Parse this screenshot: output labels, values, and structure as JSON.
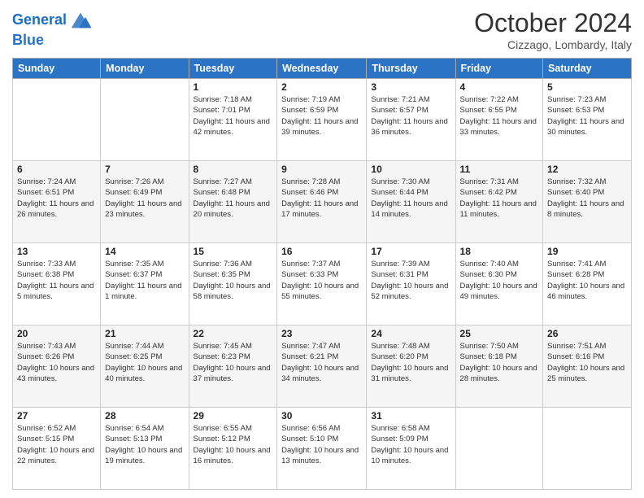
{
  "header": {
    "logo_line1": "General",
    "logo_line2": "Blue",
    "title": "October 2024",
    "subtitle": "Cizzago, Lombardy, Italy"
  },
  "days_of_week": [
    "Sunday",
    "Monday",
    "Tuesday",
    "Wednesday",
    "Thursday",
    "Friday",
    "Saturday"
  ],
  "weeks": [
    [
      {
        "day": "",
        "sunrise": "",
        "sunset": "",
        "daylight": ""
      },
      {
        "day": "",
        "sunrise": "",
        "sunset": "",
        "daylight": ""
      },
      {
        "day": "1",
        "sunrise": "Sunrise: 7:18 AM",
        "sunset": "Sunset: 7:01 PM",
        "daylight": "Daylight: 11 hours and 42 minutes."
      },
      {
        "day": "2",
        "sunrise": "Sunrise: 7:19 AM",
        "sunset": "Sunset: 6:59 PM",
        "daylight": "Daylight: 11 hours and 39 minutes."
      },
      {
        "day": "3",
        "sunrise": "Sunrise: 7:21 AM",
        "sunset": "Sunset: 6:57 PM",
        "daylight": "Daylight: 11 hours and 36 minutes."
      },
      {
        "day": "4",
        "sunrise": "Sunrise: 7:22 AM",
        "sunset": "Sunset: 6:55 PM",
        "daylight": "Daylight: 11 hours and 33 minutes."
      },
      {
        "day": "5",
        "sunrise": "Sunrise: 7:23 AM",
        "sunset": "Sunset: 6:53 PM",
        "daylight": "Daylight: 11 hours and 30 minutes."
      }
    ],
    [
      {
        "day": "6",
        "sunrise": "Sunrise: 7:24 AM",
        "sunset": "Sunset: 6:51 PM",
        "daylight": "Daylight: 11 hours and 26 minutes."
      },
      {
        "day": "7",
        "sunrise": "Sunrise: 7:26 AM",
        "sunset": "Sunset: 6:49 PM",
        "daylight": "Daylight: 11 hours and 23 minutes."
      },
      {
        "day": "8",
        "sunrise": "Sunrise: 7:27 AM",
        "sunset": "Sunset: 6:48 PM",
        "daylight": "Daylight: 11 hours and 20 minutes."
      },
      {
        "day": "9",
        "sunrise": "Sunrise: 7:28 AM",
        "sunset": "Sunset: 6:46 PM",
        "daylight": "Daylight: 11 hours and 17 minutes."
      },
      {
        "day": "10",
        "sunrise": "Sunrise: 7:30 AM",
        "sunset": "Sunset: 6:44 PM",
        "daylight": "Daylight: 11 hours and 14 minutes."
      },
      {
        "day": "11",
        "sunrise": "Sunrise: 7:31 AM",
        "sunset": "Sunset: 6:42 PM",
        "daylight": "Daylight: 11 hours and 11 minutes."
      },
      {
        "day": "12",
        "sunrise": "Sunrise: 7:32 AM",
        "sunset": "Sunset: 6:40 PM",
        "daylight": "Daylight: 11 hours and 8 minutes."
      }
    ],
    [
      {
        "day": "13",
        "sunrise": "Sunrise: 7:33 AM",
        "sunset": "Sunset: 6:38 PM",
        "daylight": "Daylight: 11 hours and 5 minutes."
      },
      {
        "day": "14",
        "sunrise": "Sunrise: 7:35 AM",
        "sunset": "Sunset: 6:37 PM",
        "daylight": "Daylight: 11 hours and 1 minute."
      },
      {
        "day": "15",
        "sunrise": "Sunrise: 7:36 AM",
        "sunset": "Sunset: 6:35 PM",
        "daylight": "Daylight: 10 hours and 58 minutes."
      },
      {
        "day": "16",
        "sunrise": "Sunrise: 7:37 AM",
        "sunset": "Sunset: 6:33 PM",
        "daylight": "Daylight: 10 hours and 55 minutes."
      },
      {
        "day": "17",
        "sunrise": "Sunrise: 7:39 AM",
        "sunset": "Sunset: 6:31 PM",
        "daylight": "Daylight: 10 hours and 52 minutes."
      },
      {
        "day": "18",
        "sunrise": "Sunrise: 7:40 AM",
        "sunset": "Sunset: 6:30 PM",
        "daylight": "Daylight: 10 hours and 49 minutes."
      },
      {
        "day": "19",
        "sunrise": "Sunrise: 7:41 AM",
        "sunset": "Sunset: 6:28 PM",
        "daylight": "Daylight: 10 hours and 46 minutes."
      }
    ],
    [
      {
        "day": "20",
        "sunrise": "Sunrise: 7:43 AM",
        "sunset": "Sunset: 6:26 PM",
        "daylight": "Daylight: 10 hours and 43 minutes."
      },
      {
        "day": "21",
        "sunrise": "Sunrise: 7:44 AM",
        "sunset": "Sunset: 6:25 PM",
        "daylight": "Daylight: 10 hours and 40 minutes."
      },
      {
        "day": "22",
        "sunrise": "Sunrise: 7:45 AM",
        "sunset": "Sunset: 6:23 PM",
        "daylight": "Daylight: 10 hours and 37 minutes."
      },
      {
        "day": "23",
        "sunrise": "Sunrise: 7:47 AM",
        "sunset": "Sunset: 6:21 PM",
        "daylight": "Daylight: 10 hours and 34 minutes."
      },
      {
        "day": "24",
        "sunrise": "Sunrise: 7:48 AM",
        "sunset": "Sunset: 6:20 PM",
        "daylight": "Daylight: 10 hours and 31 minutes."
      },
      {
        "day": "25",
        "sunrise": "Sunrise: 7:50 AM",
        "sunset": "Sunset: 6:18 PM",
        "daylight": "Daylight: 10 hours and 28 minutes."
      },
      {
        "day": "26",
        "sunrise": "Sunrise: 7:51 AM",
        "sunset": "Sunset: 6:16 PM",
        "daylight": "Daylight: 10 hours and 25 minutes."
      }
    ],
    [
      {
        "day": "27",
        "sunrise": "Sunrise: 6:52 AM",
        "sunset": "Sunset: 5:15 PM",
        "daylight": "Daylight: 10 hours and 22 minutes."
      },
      {
        "day": "28",
        "sunrise": "Sunrise: 6:54 AM",
        "sunset": "Sunset: 5:13 PM",
        "daylight": "Daylight: 10 hours and 19 minutes."
      },
      {
        "day": "29",
        "sunrise": "Sunrise: 6:55 AM",
        "sunset": "Sunset: 5:12 PM",
        "daylight": "Daylight: 10 hours and 16 minutes."
      },
      {
        "day": "30",
        "sunrise": "Sunrise: 6:56 AM",
        "sunset": "Sunset: 5:10 PM",
        "daylight": "Daylight: 10 hours and 13 minutes."
      },
      {
        "day": "31",
        "sunrise": "Sunrise: 6:58 AM",
        "sunset": "Sunset: 5:09 PM",
        "daylight": "Daylight: 10 hours and 10 minutes."
      },
      {
        "day": "",
        "sunrise": "",
        "sunset": "",
        "daylight": ""
      },
      {
        "day": "",
        "sunrise": "",
        "sunset": "",
        "daylight": ""
      }
    ]
  ]
}
